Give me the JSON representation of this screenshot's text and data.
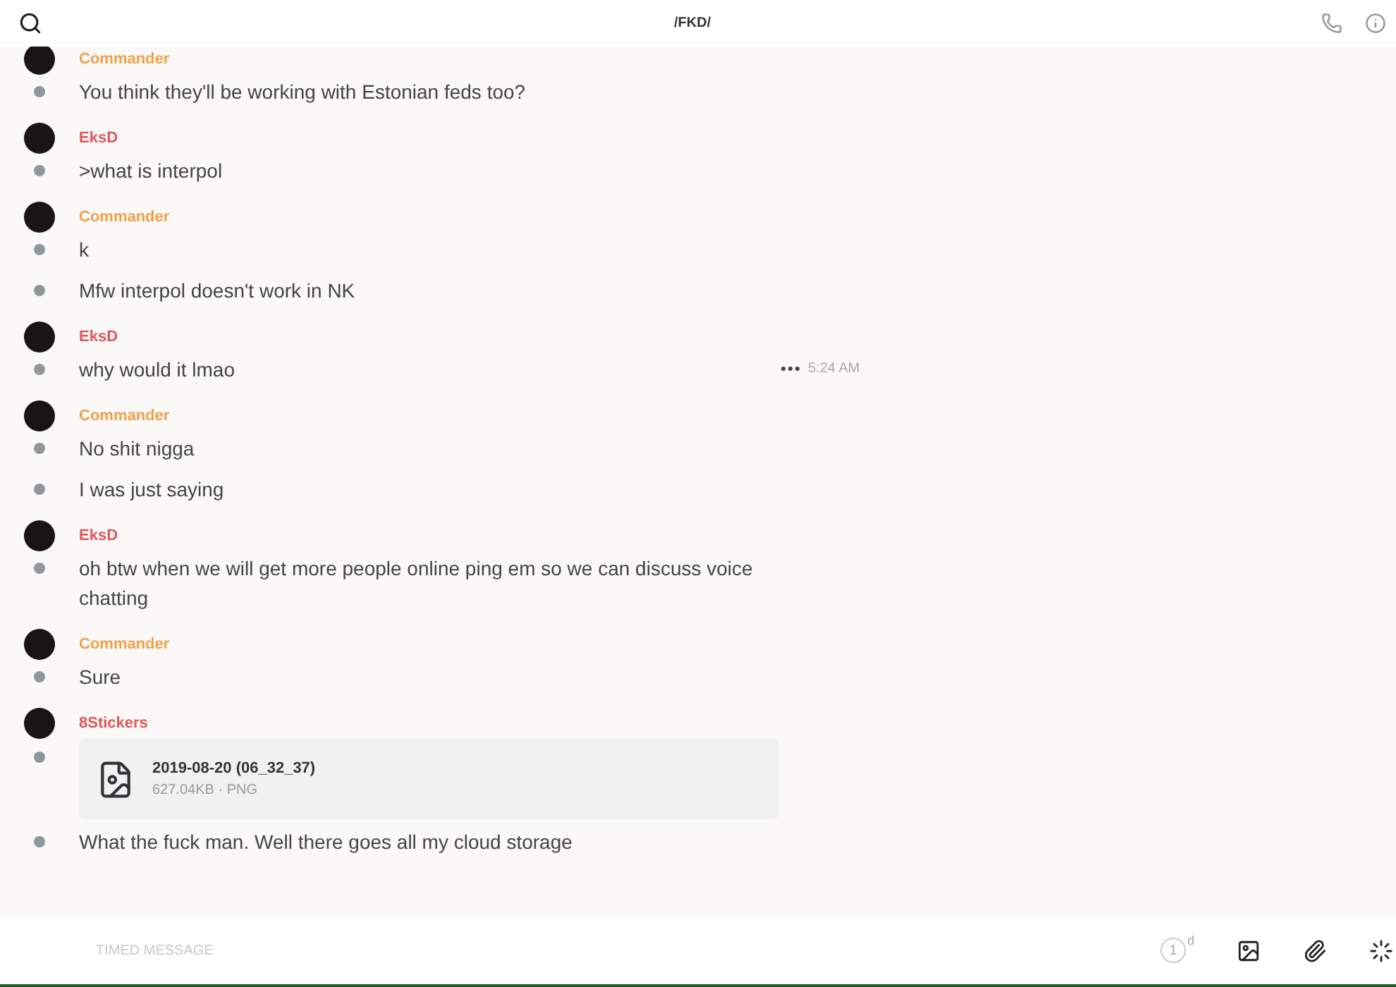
{
  "header": {
    "title": "/FKD/"
  },
  "messages": [
    {
      "author": "Commander",
      "color": "#f0a04b",
      "lines": [
        {
          "kind": "text",
          "text": "You think they'll be working with Estonian feds too?"
        }
      ]
    },
    {
      "author": "EksD",
      "color": "#e0565b",
      "lines": [
        {
          "kind": "text",
          "text": ">what is interpol"
        }
      ]
    },
    {
      "author": "Commander",
      "color": "#f0a04b",
      "lines": [
        {
          "kind": "text",
          "text": "k"
        },
        {
          "kind": "text",
          "text": "Mfw interpol doesn't work in NK"
        }
      ]
    },
    {
      "author": "EksD",
      "color": "#e0565b",
      "lines": [
        {
          "kind": "text",
          "text": "why would it lmao",
          "time": "5:24 AM"
        }
      ]
    },
    {
      "author": "Commander",
      "color": "#f0a04b",
      "lines": [
        {
          "kind": "text",
          "text": "No shit nigga"
        },
        {
          "kind": "text",
          "text": "I was just saying"
        }
      ]
    },
    {
      "author": "EksD",
      "color": "#e0565b",
      "lines": [
        {
          "kind": "text",
          "text": "oh btw when we will get more people online ping em so we can discuss voice chatting"
        }
      ]
    },
    {
      "author": "Commander",
      "color": "#f0a04b",
      "lines": [
        {
          "kind": "text",
          "text": "Sure"
        }
      ]
    },
    {
      "author": "8Stickers",
      "color": "#e0565b",
      "lines": [
        {
          "kind": "file",
          "name": "2019-08-20 (06_32_37)",
          "meta": "627.04KB · PNG"
        },
        {
          "kind": "text",
          "text": "What the fuck man. Well there goes all my cloud storage"
        }
      ]
    }
  ],
  "composer": {
    "placeholder": "TIMED MESSAGE",
    "timer": {
      "value": "1",
      "unit": "d"
    }
  }
}
